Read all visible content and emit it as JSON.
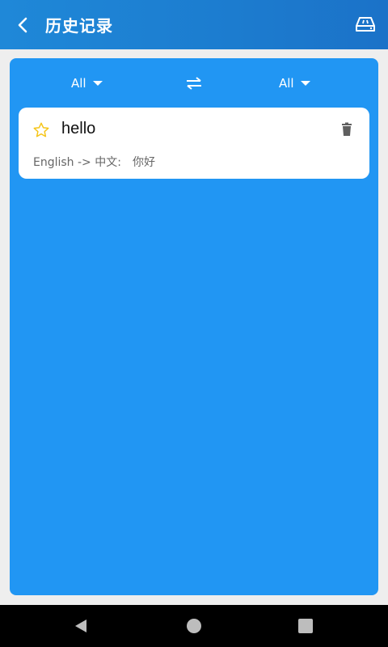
{
  "header": {
    "title": "历史记录"
  },
  "languages": {
    "source": "All",
    "target": "All"
  },
  "history": [
    {
      "word": "hello",
      "direction": "English -> 中文:",
      "translation": "你好"
    }
  ],
  "colors": {
    "header": "#1c7ccf",
    "panel": "#2196f3",
    "star": "#f5c518",
    "card": "#ffffff"
  },
  "icons": {
    "back": "arrow-back-icon",
    "clear": "eraser-icon",
    "swap": "swap-icon",
    "favorite": "star-outline-icon",
    "delete": "trash-icon"
  }
}
